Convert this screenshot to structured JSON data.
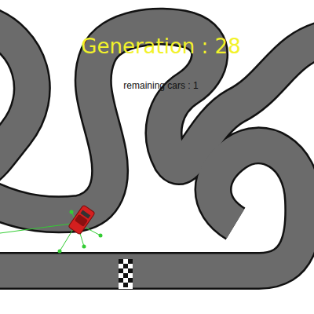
{
  "hud": {
    "generation": "Generation : 28",
    "remaining_cars": "remaining cars : 1"
  }
}
